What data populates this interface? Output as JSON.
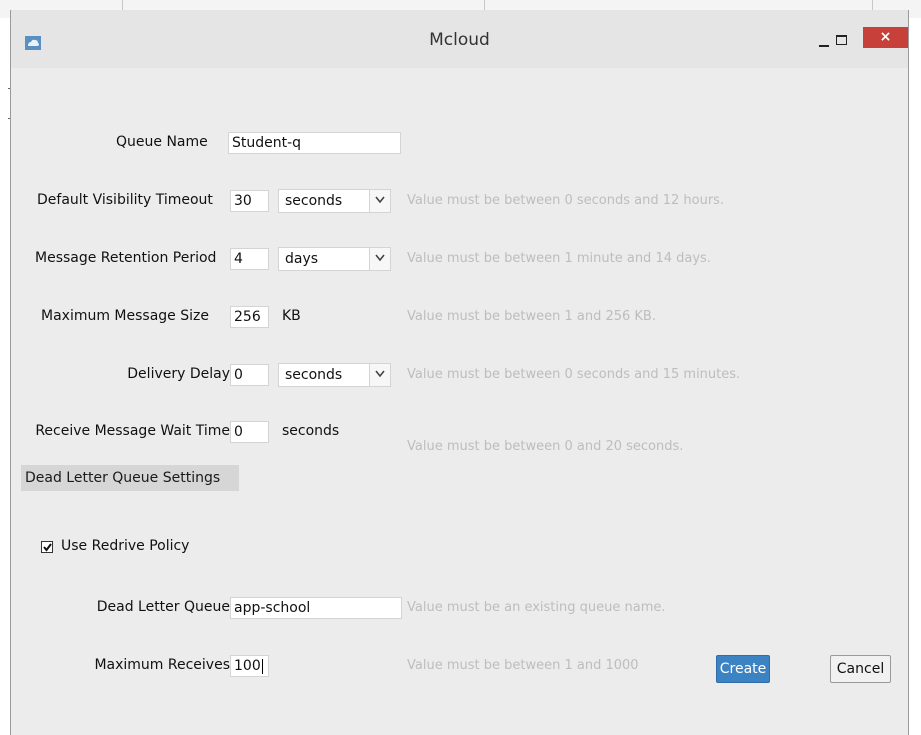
{
  "window": {
    "title": "Mcloud",
    "close_glyph": "×"
  },
  "form": {
    "queue_name": {
      "label": "Queue Name",
      "value": "Student-q"
    },
    "visibility_timeout": {
      "label": "Default Visibility Timeout",
      "value": "30",
      "unit": "seconds",
      "hint": "Value must be between 0 seconds and 12 hours."
    },
    "retention_period": {
      "label": "Message Retention Period",
      "value": "4",
      "unit": "days",
      "hint": "Value must be between 1 minute and 14 days."
    },
    "max_message_size": {
      "label": "Maximum Message Size",
      "value": "256",
      "unit": "KB",
      "hint": "Value must be between 1  and 256 KB."
    },
    "delivery_delay": {
      "label": "Delivery Delay",
      "value": "0",
      "unit": "seconds",
      "hint": "Value must be between 0 seconds and 15 minutes."
    },
    "receive_wait_time": {
      "label": "Receive Message Wait Time",
      "value": "0",
      "unit": "seconds",
      "hint": "Value must be between 0  and 20 seconds."
    }
  },
  "dead_letter": {
    "section_title": "Dead Letter Queue Settings",
    "use_redrive_policy": {
      "label": "Use Redrive Policy",
      "checked": true
    },
    "dead_letter_queue": {
      "label": "Dead Letter Queue",
      "value": "app-school",
      "hint": "Value must be an existing queue name."
    },
    "max_receives": {
      "label": "Maximum Receives",
      "value": "100",
      "hint": "Value must be between 1 and 1000"
    }
  },
  "buttons": {
    "create": "Create",
    "cancel": "Cancel"
  },
  "colors": {
    "accent": "#3c83c4",
    "close": "#c7403a",
    "hint": "#bdbdbd",
    "window_bg": "#ececec"
  }
}
